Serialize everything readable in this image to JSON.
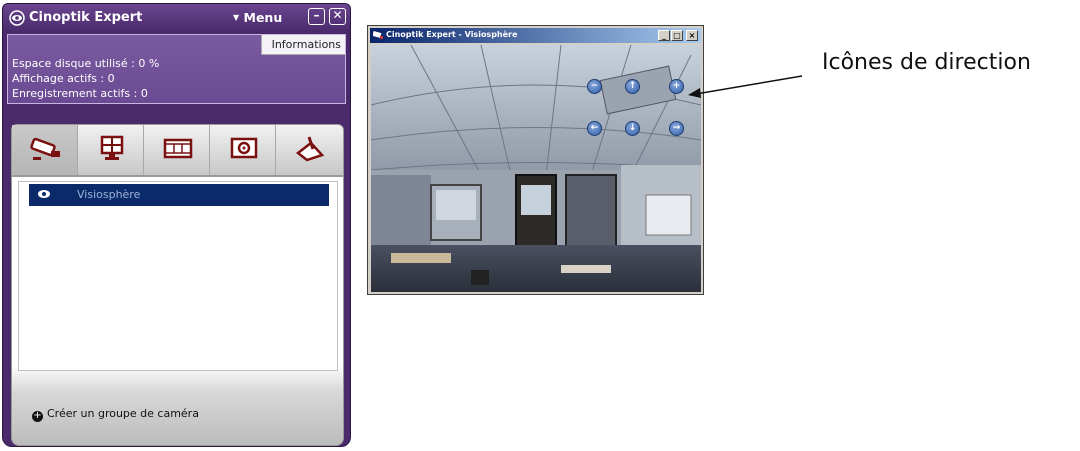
{
  "main_window": {
    "title": "Cinoptik Expert",
    "menu_label": "Menu",
    "info_tab_label": "Informations",
    "info_lines": [
      "Espace disque utilisé : 0 %",
      "Affichage actifs : 0",
      "Enregistrement actifs : 0"
    ],
    "tabs": [
      {
        "name": "camera-icon"
      },
      {
        "name": "monitor-icon"
      },
      {
        "name": "film-icon"
      },
      {
        "name": "snapshot-icon"
      },
      {
        "name": "settings-icon"
      }
    ],
    "camera_list": [
      {
        "label": "Visiosphère",
        "icon": "eye-icon",
        "selected": true
      }
    ],
    "create_group_label": "Créer un groupe de caméra"
  },
  "video_window": {
    "title": "Cinoptik Expert - Visiosphère",
    "buttons": [
      "_",
      "□",
      "×"
    ],
    "direction_buttons": [
      {
        "name": "zoom-out-icon",
        "glyph": "−"
      },
      {
        "name": "arrow-up-icon",
        "glyph": "↑"
      },
      {
        "name": "zoom-in-icon",
        "glyph": "+"
      },
      {
        "name": "arrow-left-icon",
        "glyph": "←"
      },
      {
        "name": "arrow-down-icon",
        "glyph": "↓"
      },
      {
        "name": "arrow-right-icon",
        "glyph": "→"
      }
    ]
  },
  "annotation": {
    "label": "Icônes de direction"
  }
}
